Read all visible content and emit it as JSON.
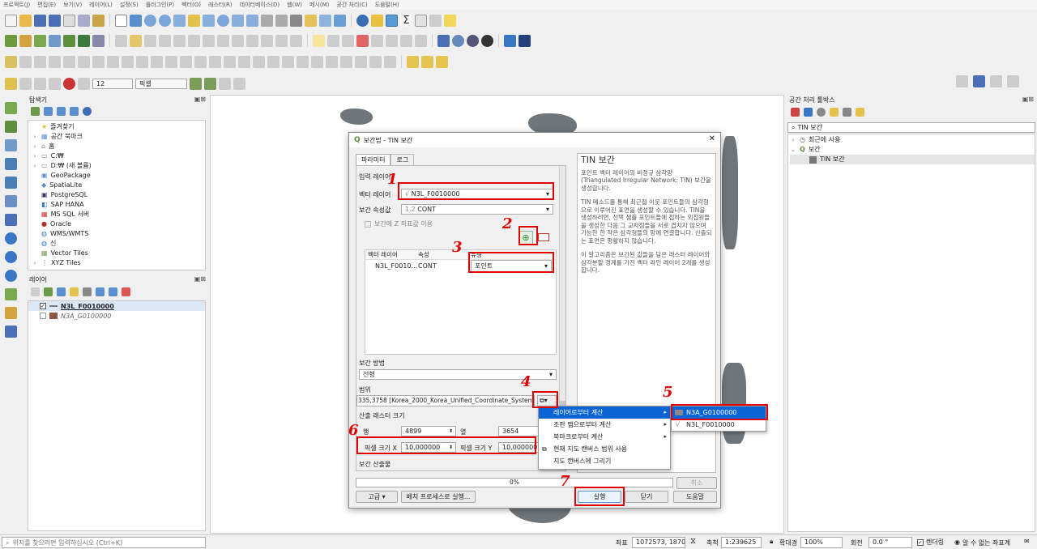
{
  "menubar": [
    "프로젝트(J)",
    "편집(E)",
    "보기(V)",
    "레이어(L)",
    "설정(S)",
    "플러그인(P)",
    "벡터(O)",
    "래스터(R)",
    "데이터베이스(D)",
    "웹(W)",
    "메시(M)",
    "공간 처리(C)",
    "도움말(H)"
  ],
  "toolbar3": {
    "snap_tolerance": "12",
    "snap_unit": "픽셀"
  },
  "browser": {
    "title": "탐색기",
    "items": [
      "즐겨찾기",
      "공간 북마크",
      "홈",
      "C:₩",
      "D:₩ (새 볼륨)",
      "GeoPackage",
      "SpatiaLite",
      "PostgreSQL",
      "SAP HANA",
      "MS SQL 서버",
      "Oracle",
      "WMS/WMTS",
      "신",
      "Vector Tiles",
      "XYZ Tiles"
    ]
  },
  "layers": {
    "title": "레이어",
    "items": [
      "N3L_F0010000",
      "N3A_G0100000"
    ]
  },
  "toolbox": {
    "title": "공간 처리 툴박스",
    "search": "TIN 보간",
    "items": [
      "최근에 사용",
      "보간",
      "TIN 보간"
    ]
  },
  "dialog": {
    "title": "보간법 - TIN 보간",
    "tabs": [
      "파라미터",
      "로그"
    ],
    "input_layer_label": "입력 레이어",
    "vector_layer_label": "벡터 레이어",
    "vector_layer_value": "N3L_F0010000",
    "interp_attr_label": "보간 속성값",
    "interp_attr_value": "CONT",
    "z_checkbox": "보간에 Z 좌표값 이용",
    "table_headers": [
      "벡터 레이어",
      "속성",
      "유형"
    ],
    "table_row": [
      "N3L_F0010...",
      "CONT",
      "포인트"
    ],
    "method_label": "보간 방법",
    "method_value": "선형",
    "extent_label": "범위",
    "extent_value": "335,3758 [Korea_2000_Korea_Unified_Coordinate_System]",
    "raster_size_label": "산출 래스터 크기",
    "rows_label": "행",
    "rows_value": "4899",
    "cols_label": "열",
    "cols_value": "3654",
    "pixel_x_label": "픽셀 크기 X",
    "pixel_x_value": "10,000000",
    "pixel_y_label": "픽셀 크기 Y",
    "pixel_y_value": "10,000000",
    "next_label": "보간 산출물",
    "progress": "0%",
    "progress_value": 0,
    "cancel": "취소",
    "advanced": "고급",
    "batch": "배치 프로세스로 실행...",
    "run": "실행",
    "close": "닫기",
    "help": "도움말",
    "help_title": "TIN 보간",
    "help_p1": "포인트 벡터 레이어의 비정규 삼각망(Triangulated Irregular Network: TIN) 보간을 생성합니다.",
    "help_p2": "TIN 메소드를 통해 최근접 이웃 포인트들의 삼각형으로 이루어진 표면을 생성할 수 있습니다. TIN을 생성하려면, 선택 샘플 포인트들에 접하는 외접원들을 생성한 다음 그 교차점들을 서로 겹치지 않으며 가능한 한 작은 삼각형들의 망에 연결합니다. 산출되는 표면은 평활하지 않습니다.",
    "help_p3": "이 알고리즘은 보간된 값들을 담은 래스터 레이어와 삼각분할 경계를 가진 벡터 라인 레이어 2개를 생성합니다."
  },
  "context_menu": [
    "레이어로부터 계산",
    "조판 맵으로부터 계산",
    "북마크로부터 계산",
    "현재 지도 캔버스 범위 사용",
    "지도 캔버스에 그리기"
  ],
  "submenu": [
    "N3A_G0100000",
    "N3L_F0010000"
  ],
  "annotations": [
    "1",
    "2",
    "3",
    "4",
    "5",
    "6",
    "7"
  ],
  "statusbar": {
    "locator": "위치를 찾으려면 입력하십시오 (Ctrl+K)",
    "coord_label": "좌표",
    "coord": "1072573, 1870044",
    "scale_label": "축척",
    "scale": "1:239625",
    "mag_label": "확대경",
    "mag": "100%",
    "rot_label": "회전",
    "rot": "0.0 °",
    "render": "렌더링",
    "crs": "알 수 없는 좌표계"
  }
}
